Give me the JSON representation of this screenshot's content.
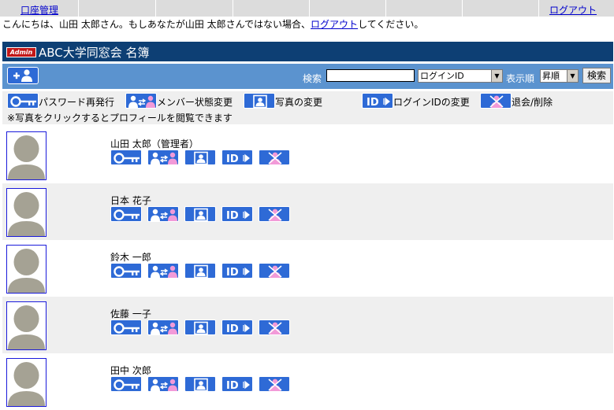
{
  "topnav": {
    "account_link": "口座管理",
    "logout_link": "ログアウト"
  },
  "greeting": {
    "prefix": "こんにちは、山田 太郎さん。もしあなたが山田 太郎さんではない場合、",
    "logout_link": "ログアウト",
    "suffix": "してください。"
  },
  "header": {
    "badge": "Admin",
    "title": "ABC大学同窓会 名簿"
  },
  "toolbar": {
    "add_icon": "add-user-icon",
    "search_label": "検索",
    "search_value": "",
    "search_field_option": "ログインID",
    "sort_label": "表示順",
    "sort_option": "昇順",
    "search_button": "検索"
  },
  "legend": {
    "items": [
      {
        "icon": "key-icon",
        "label": "パスワード再発行"
      },
      {
        "icon": "member-status-icon",
        "label": "メンバー状態変更"
      },
      {
        "icon": "photo-icon",
        "label": "写真の変更"
      },
      {
        "icon": "id-icon",
        "label": "ログインIDの変更"
      },
      {
        "icon": "withdraw-icon",
        "label": "退会/削除"
      }
    ],
    "note": "※写真をクリックするとプロフィールを閲覧できます"
  },
  "members": [
    {
      "name": "山田 太郎（管理者）"
    },
    {
      "name": "日本 花子"
    },
    {
      "name": "鈴木 一郎"
    },
    {
      "name": "佐藤 一子"
    },
    {
      "name": "田中 次郎"
    }
  ],
  "colors": {
    "header_bg": "#0d3f74",
    "toolbar_bg": "#5b93cf",
    "icon_bg": "#2e6ad6",
    "row_alt_bg": "#efefef",
    "link": "#0000cc"
  }
}
